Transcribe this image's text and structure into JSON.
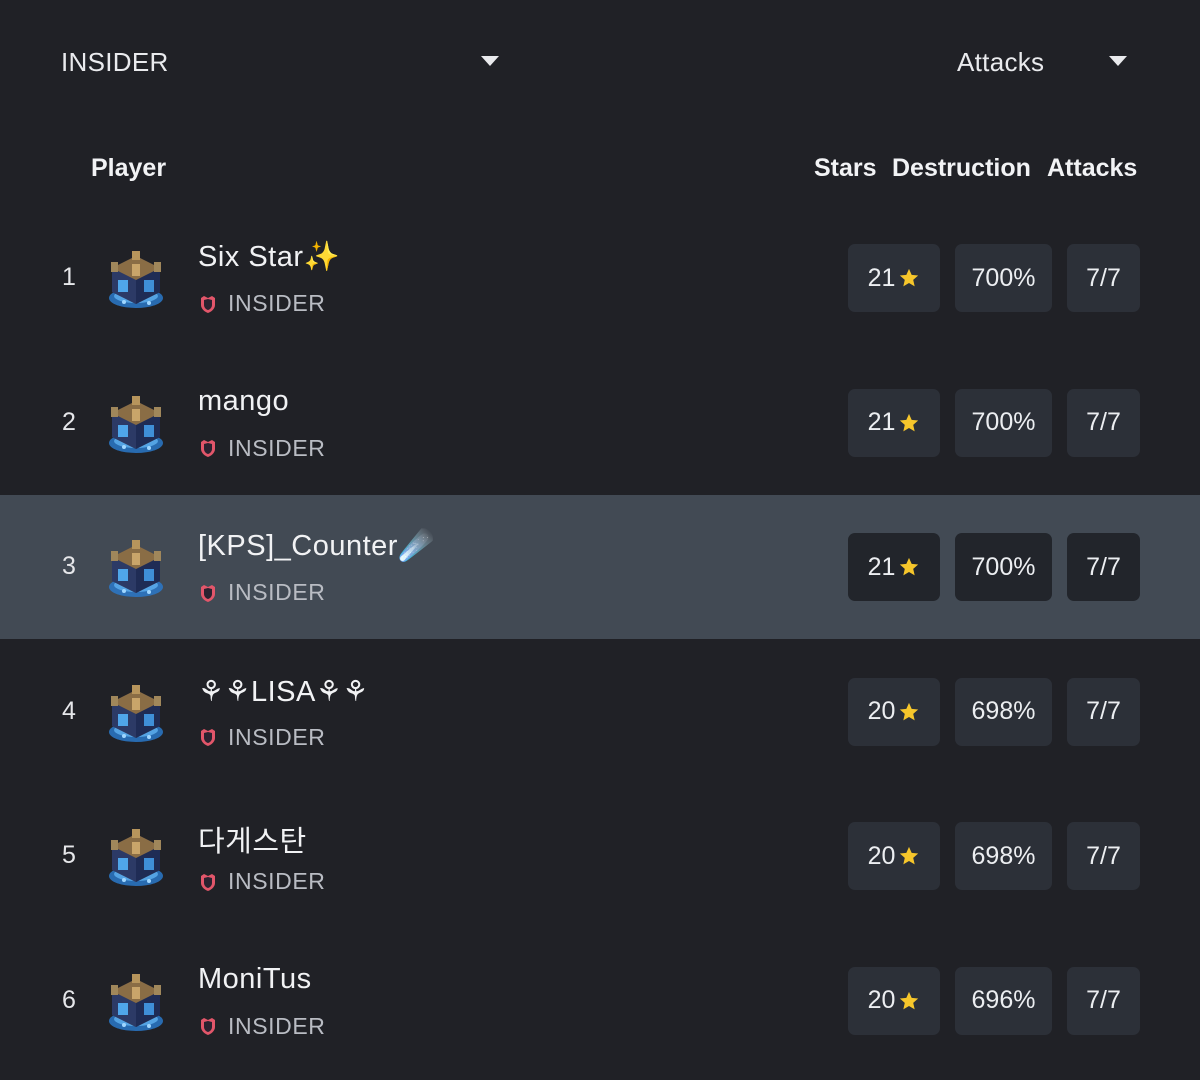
{
  "filters": {
    "clan_label": "INSIDER",
    "sort_label": "Attacks"
  },
  "table": {
    "headers": {
      "player": "Player",
      "stars": "Stars",
      "destruction": "Destruction",
      "attacks": "Attacks"
    },
    "rows": [
      {
        "rank": "1",
        "name": "Six Star✨",
        "clan": "INSIDER",
        "stars": "21",
        "destruction": "700%",
        "attacks": "7/7",
        "highlighted": false
      },
      {
        "rank": "2",
        "name": "mango",
        "clan": "INSIDER",
        "stars": "21",
        "destruction": "700%",
        "attacks": "7/7",
        "highlighted": false
      },
      {
        "rank": "3",
        "name": "[KPS]_Counter☄️",
        "clan": "INSIDER",
        "stars": "21",
        "destruction": "700%",
        "attacks": "7/7",
        "highlighted": true
      },
      {
        "rank": "4",
        "name": "⚘⚘LISA⚘⚘",
        "clan": "INSIDER",
        "stars": "20",
        "destruction": "698%",
        "attacks": "7/7",
        "highlighted": false
      },
      {
        "rank": "5",
        "name": "다게스탄",
        "clan": "INSIDER",
        "stars": "20",
        "destruction": "698%",
        "attacks": "7/7",
        "highlighted": false
      },
      {
        "rank": "6",
        "name": "MoniTus",
        "clan": "INSIDER",
        "stars": "20",
        "destruction": "696%",
        "attacks": "7/7",
        "highlighted": false
      }
    ]
  },
  "icons": {
    "avatar": "town-hall-icon",
    "clan": "clan-badge-icon",
    "star": "star-icon",
    "dropdown": "caret-down-icon"
  },
  "colors": {
    "background": "#202126",
    "highlight_row": "#424a54",
    "stat_box": "#2c3038",
    "star": "#f6c62b",
    "clan_badge": "#e2566a"
  }
}
